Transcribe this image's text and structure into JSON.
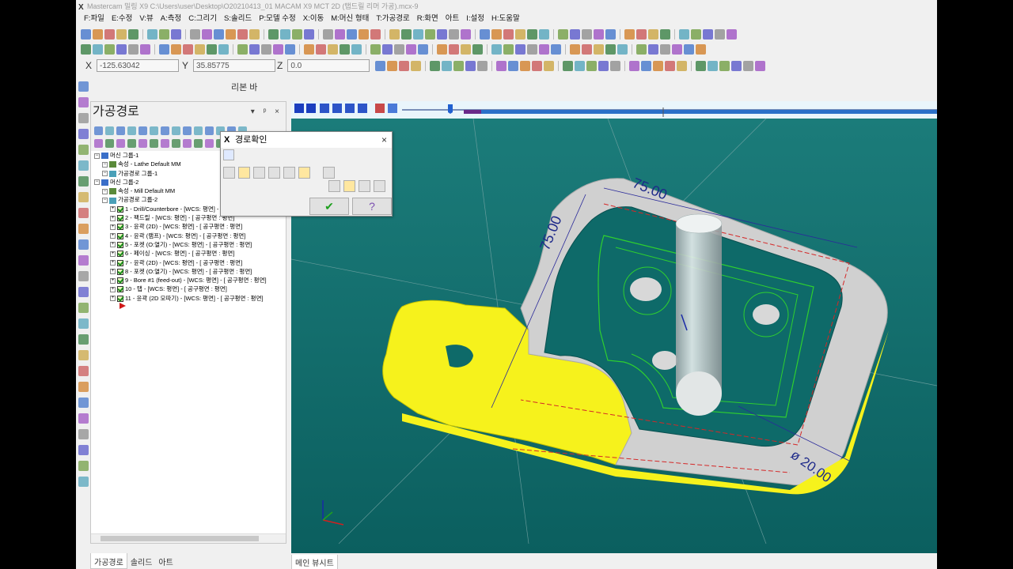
{
  "titlebar": {
    "text": "Mastercam 밀링 X9  C:\\Users\\user\\Desktop\\O20210413_01 MACAM X9 MCT 2D (탭드릴 리머 가공).mcx-9"
  },
  "menu": [
    "F:파일",
    "E:수정",
    "V:뷰",
    "A:측정",
    "C:그리기",
    "S:솔리드",
    "P:모델 수정",
    "X:이동",
    "M:머신 형태",
    "T:가공경로",
    "R:화면",
    "아트",
    "I:설정",
    "H:도움말"
  ],
  "coords": {
    "x_label": "X",
    "x_value": "-125.63042",
    "y_label": "Y",
    "y_value": "35.85775",
    "z_label": "Z",
    "z_value": "0.0"
  },
  "ribbon_label": "리본 바",
  "panel": {
    "title": "가공경로",
    "controls": "▾ ᵖ ×",
    "tree": [
      {
        "level": 0,
        "icon": "machine-icon",
        "text": "머신 그룹-1"
      },
      {
        "level": 1,
        "icon": "properties-icon",
        "text": "속성 - Lathe Default MM"
      },
      {
        "level": 1,
        "icon": "toolpath-group-icon",
        "text": "가공경로 그룹-1"
      },
      {
        "level": 0,
        "icon": "machine-icon",
        "text": "머신 그룹-2"
      },
      {
        "level": 1,
        "icon": "properties-icon",
        "text": "속성 - Mill Default MM"
      },
      {
        "level": 1,
        "icon": "toolpath-group-icon",
        "text": "가공경로 그룹-2"
      },
      {
        "level": 2,
        "icon": "check",
        "text": "1 - Drill/Counterbore - [WCS: 평면] - [ 공구평면 : 평면]"
      },
      {
        "level": 2,
        "icon": "check",
        "text": "2 - 팩드릴 - [WCS: 평면] - [ 공구평면 : 평면]"
      },
      {
        "level": 2,
        "icon": "check",
        "text": "3 - 윤곽 (2D) - [WCS: 평면] - [ 공구평면 : 평면]"
      },
      {
        "level": 2,
        "icon": "check",
        "text": "4 - 윤곽 (램프) - [WCS: 평면] - [ 공구평면 : 평면]"
      },
      {
        "level": 2,
        "icon": "check",
        "text": "5 - 포켓 (O:열기) - [WCS: 평면] - [ 공구평면 : 평면]"
      },
      {
        "level": 2,
        "icon": "check",
        "text": "6 - 페이싱 - [WCS: 평면] - [ 공구평면 : 평면]"
      },
      {
        "level": 2,
        "icon": "check",
        "text": "7 - 윤곽 (2D) - [WCS: 평면] - [ 공구평면 : 평면]"
      },
      {
        "level": 2,
        "icon": "check",
        "text": "8 - 포켓 (O:열기) - [WCS: 평면] - [ 공구평면 : 평면]"
      },
      {
        "level": 2,
        "icon": "check",
        "text": "9 - Bore #1 (feed-out) - [WCS: 평면] - [ 공구평면 : 평면]"
      },
      {
        "level": 2,
        "icon": "check",
        "text": "10 - 탭 - [WCS: 평면] - [ 공구평면 : 평면]"
      },
      {
        "level": 2,
        "icon": "check",
        "text": "11 - 윤곽 (2D 모따기) - [WCS: 평면] - [ 공구평면 : 평면]"
      }
    ]
  },
  "bottom_tabs": [
    "가공경로",
    "솔리드",
    "아트"
  ],
  "viewport_tab": "메인 뷰시트",
  "dialog": {
    "title": "경로확인",
    "close": "×",
    "ok_glyph": "✔",
    "help_glyph": "?"
  },
  "drawing": {
    "dim_75_top": "75.00",
    "dim_75_left": "75.00",
    "dim_diameter": "ø 20.00"
  },
  "colors": {
    "viewport_bg_top": "#e8f4fa",
    "viewport_bg": "#0f6b6a",
    "part_gray": "#cfcfcf",
    "highlight_yellow": "#f6f21c"
  }
}
